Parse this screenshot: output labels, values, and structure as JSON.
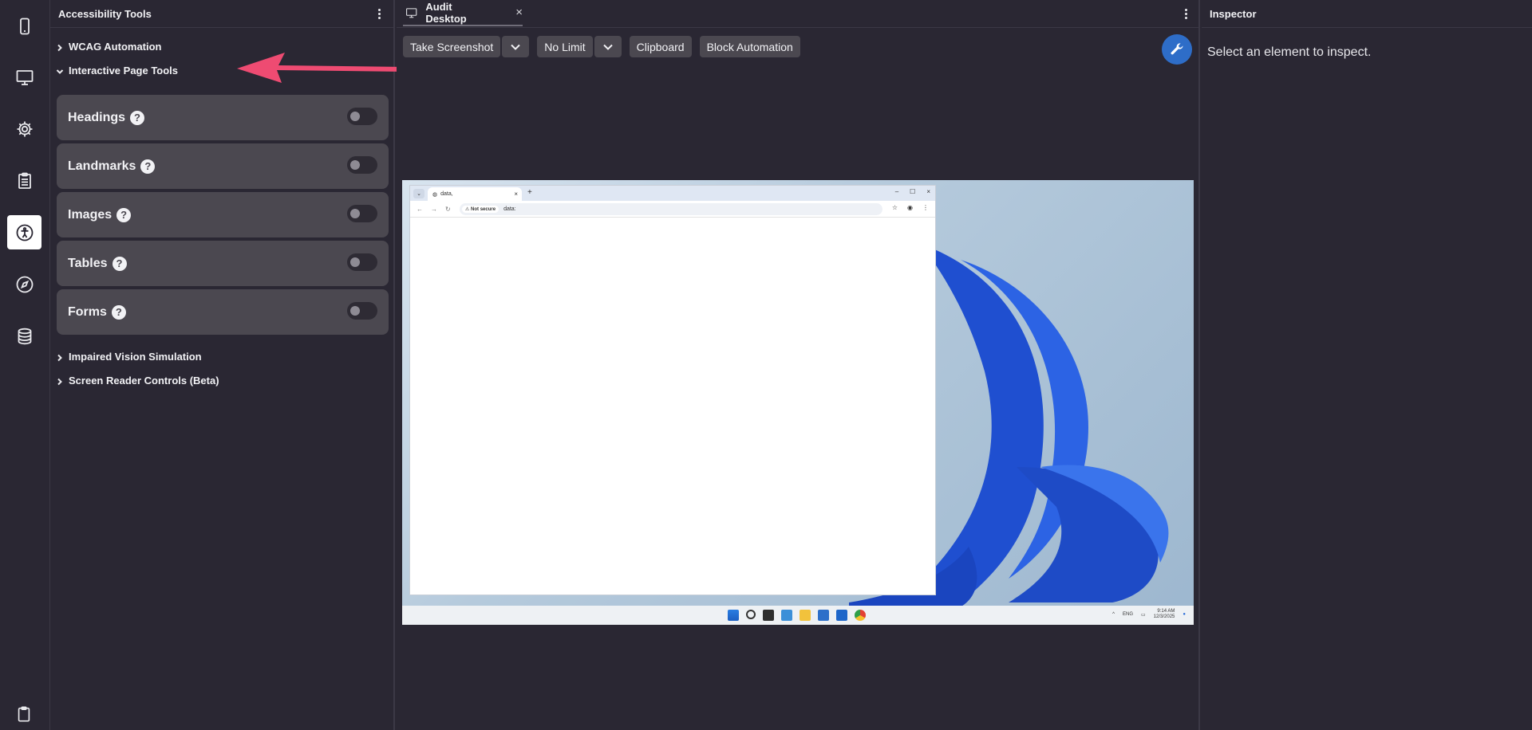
{
  "rail": {
    "items": [
      {
        "name": "mobile-icon"
      },
      {
        "name": "desktop-icon"
      },
      {
        "name": "gear-icon"
      },
      {
        "name": "checklist-icon"
      },
      {
        "name": "accessibility-icon",
        "active": true
      },
      {
        "name": "compass-icon"
      },
      {
        "name": "database-icon"
      }
    ],
    "bottom_icon": "clipboard-icon"
  },
  "a11y_panel": {
    "title": "Accessibility Tools",
    "sections": [
      {
        "label": "WCAG Automation",
        "expanded": false
      },
      {
        "label": "Interactive Page Tools",
        "expanded": true
      },
      {
        "label": "Impaired Vision Simulation",
        "expanded": false
      },
      {
        "label": "Screen Reader Controls (Beta)",
        "expanded": false
      }
    ],
    "tools": [
      {
        "label": "Headings",
        "enabled": false
      },
      {
        "label": "Landmarks",
        "enabled": false
      },
      {
        "label": "Images",
        "enabled": false
      },
      {
        "label": "Tables",
        "enabled": false
      },
      {
        "label": "Forms",
        "enabled": false
      }
    ],
    "help_glyph": "?"
  },
  "center": {
    "tab": {
      "label": "Audit Desktop",
      "close": "×"
    },
    "toolbar": {
      "screenshot_label": "Take Screenshot",
      "limit_label": "No Limit",
      "clipboard_label": "Clipboard",
      "block_label": "Block Automation"
    },
    "remote_desktop": {
      "browser_tab_title": "data,",
      "new_tab": "+",
      "not_secure": "Not secure",
      "url": "data:",
      "window_controls": [
        "–",
        "☐",
        "×"
      ],
      "tray_lang": "ENG",
      "time": "9:14 AM",
      "date": "12/3/2025"
    }
  },
  "inspector": {
    "title": "Inspector",
    "message": "Select an element to inspect."
  },
  "colors": {
    "background": "#2a2733",
    "card": "#4b4850",
    "accent_blue": "#2e6dc8",
    "arrow": "#ee4b72"
  }
}
